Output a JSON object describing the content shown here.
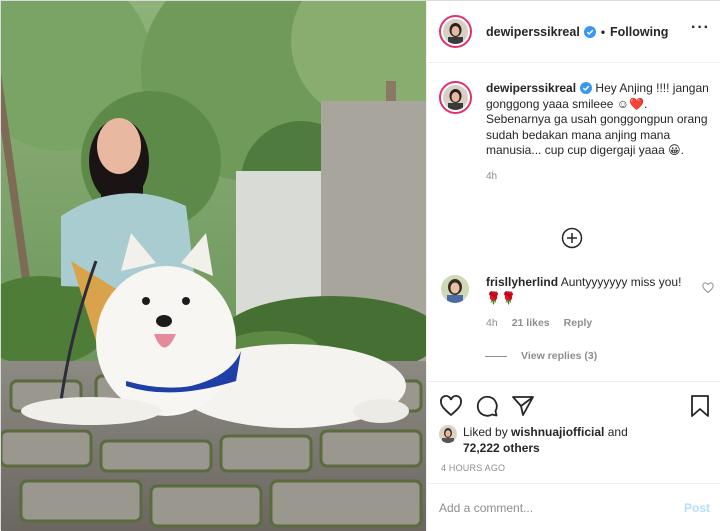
{
  "post": {
    "username": "dewiperssikreal",
    "follow_state": "Following",
    "separator": "•",
    "more": "···"
  },
  "caption": {
    "username": "dewiperssikreal",
    "text": "Hey Anjing !!!! jangan gonggong yaaa smileee ☺❤️. Sebenarnya ga usah gonggongpun orang sudah bedakan mana anjing mana manusia... cup cup digergaji yaaa 😀.",
    "time": "4h"
  },
  "comment": {
    "username": "frisllyherlind",
    "text": "Auntyyyyyyy miss you!🌹🌹",
    "time": "4h",
    "likes": "21 likes",
    "reply": "Reply"
  },
  "view_replies": "View replies (3)",
  "likes": {
    "prefix": "Liked by",
    "user": "wishnuajiofficial",
    "conj": "and",
    "others": "72,222 others"
  },
  "posted": "4 HOURS AGO",
  "add_comment": {
    "placeholder": "Add a comment...",
    "post_label": "Post"
  },
  "colors": {
    "verified": "#3897f0",
    "story_ring": "#e1306c",
    "post_disabled": "#b2dffc",
    "secondary_text": "#8e8e8e"
  }
}
